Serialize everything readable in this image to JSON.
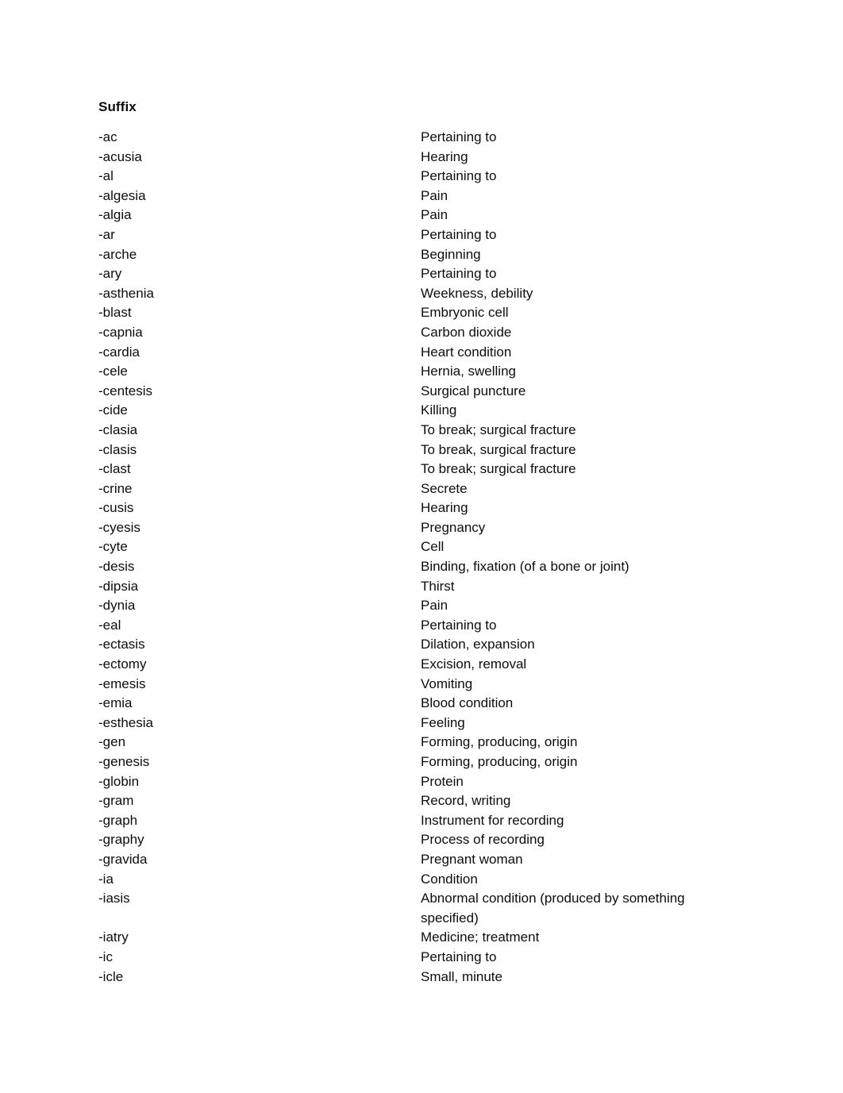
{
  "document": {
    "title": "Suffix",
    "entries": [
      {
        "term": "-ac",
        "definition": "Pertaining to"
      },
      {
        "term": "-acusia",
        "definition": "Hearing"
      },
      {
        "term": "-al",
        "definition": "Pertaining to"
      },
      {
        "term": "-algesia",
        "definition": "Pain"
      },
      {
        "term": "-algia",
        "definition": "Pain"
      },
      {
        "term": "-ar",
        "definition": "Pertaining to"
      },
      {
        "term": "-arche",
        "definition": "Beginning"
      },
      {
        "term": "-ary",
        "definition": "Pertaining to"
      },
      {
        "term": "-asthenia",
        "definition": "Weekness, debility"
      },
      {
        "term": "-blast",
        "definition": "Embryonic cell"
      },
      {
        "term": "-capnia",
        "definition": "Carbon dioxide"
      },
      {
        "term": "-cardia",
        "definition": "Heart condition"
      },
      {
        "term": "-cele",
        "definition": "Hernia, swelling"
      },
      {
        "term": "-centesis",
        "definition": "Surgical puncture"
      },
      {
        "term": "-cide",
        "definition": "Killing"
      },
      {
        "term": "-clasia",
        "definition": "To break; surgical fracture"
      },
      {
        "term": "-clasis",
        "definition": "To break, surgical fracture"
      },
      {
        "term": "-clast",
        "definition": "To break; surgical fracture"
      },
      {
        "term": "-crine",
        "definition": "Secrete"
      },
      {
        "term": "-cusis",
        "definition": "Hearing"
      },
      {
        "term": "-cyesis",
        "definition": "Pregnancy"
      },
      {
        "term": "-cyte",
        "definition": "Cell"
      },
      {
        "term": "-desis",
        "definition": "Binding, fixation (of a bone or joint)"
      },
      {
        "term": "-dipsia",
        "definition": "Thirst"
      },
      {
        "term": "-dynia",
        "definition": "Pain"
      },
      {
        "term": "-eal",
        "definition": "Pertaining to"
      },
      {
        "term": "-ectasis",
        "definition": "Dilation, expansion"
      },
      {
        "term": "-ectomy",
        "definition": "Excision, removal"
      },
      {
        "term": "-emesis",
        "definition": "Vomiting"
      },
      {
        "term": "-emia",
        "definition": "Blood condition"
      },
      {
        "term": "-esthesia",
        "definition": "Feeling"
      },
      {
        "term": "-gen",
        "definition": "Forming, producing, origin"
      },
      {
        "term": "-genesis",
        "definition": "Forming, producing, origin"
      },
      {
        "term": "-globin",
        "definition": "Protein"
      },
      {
        "term": "-gram",
        "definition": "Record, writing"
      },
      {
        "term": "-graph",
        "definition": "Instrument for recording"
      },
      {
        "term": "-graphy",
        "definition": "Process of recording"
      },
      {
        "term": "-gravida",
        "definition": "Pregnant woman"
      },
      {
        "term": "-ia",
        "definition": "Condition"
      },
      {
        "term": "-iasis",
        "definition": "Abnormal condition (produced by something specified)"
      },
      {
        "term": "-iatry",
        "definition": "Medicine; treatment"
      },
      {
        "term": "-ic",
        "definition": "Pertaining to"
      },
      {
        "term": "-icle",
        "definition": "Small, minute"
      }
    ]
  }
}
